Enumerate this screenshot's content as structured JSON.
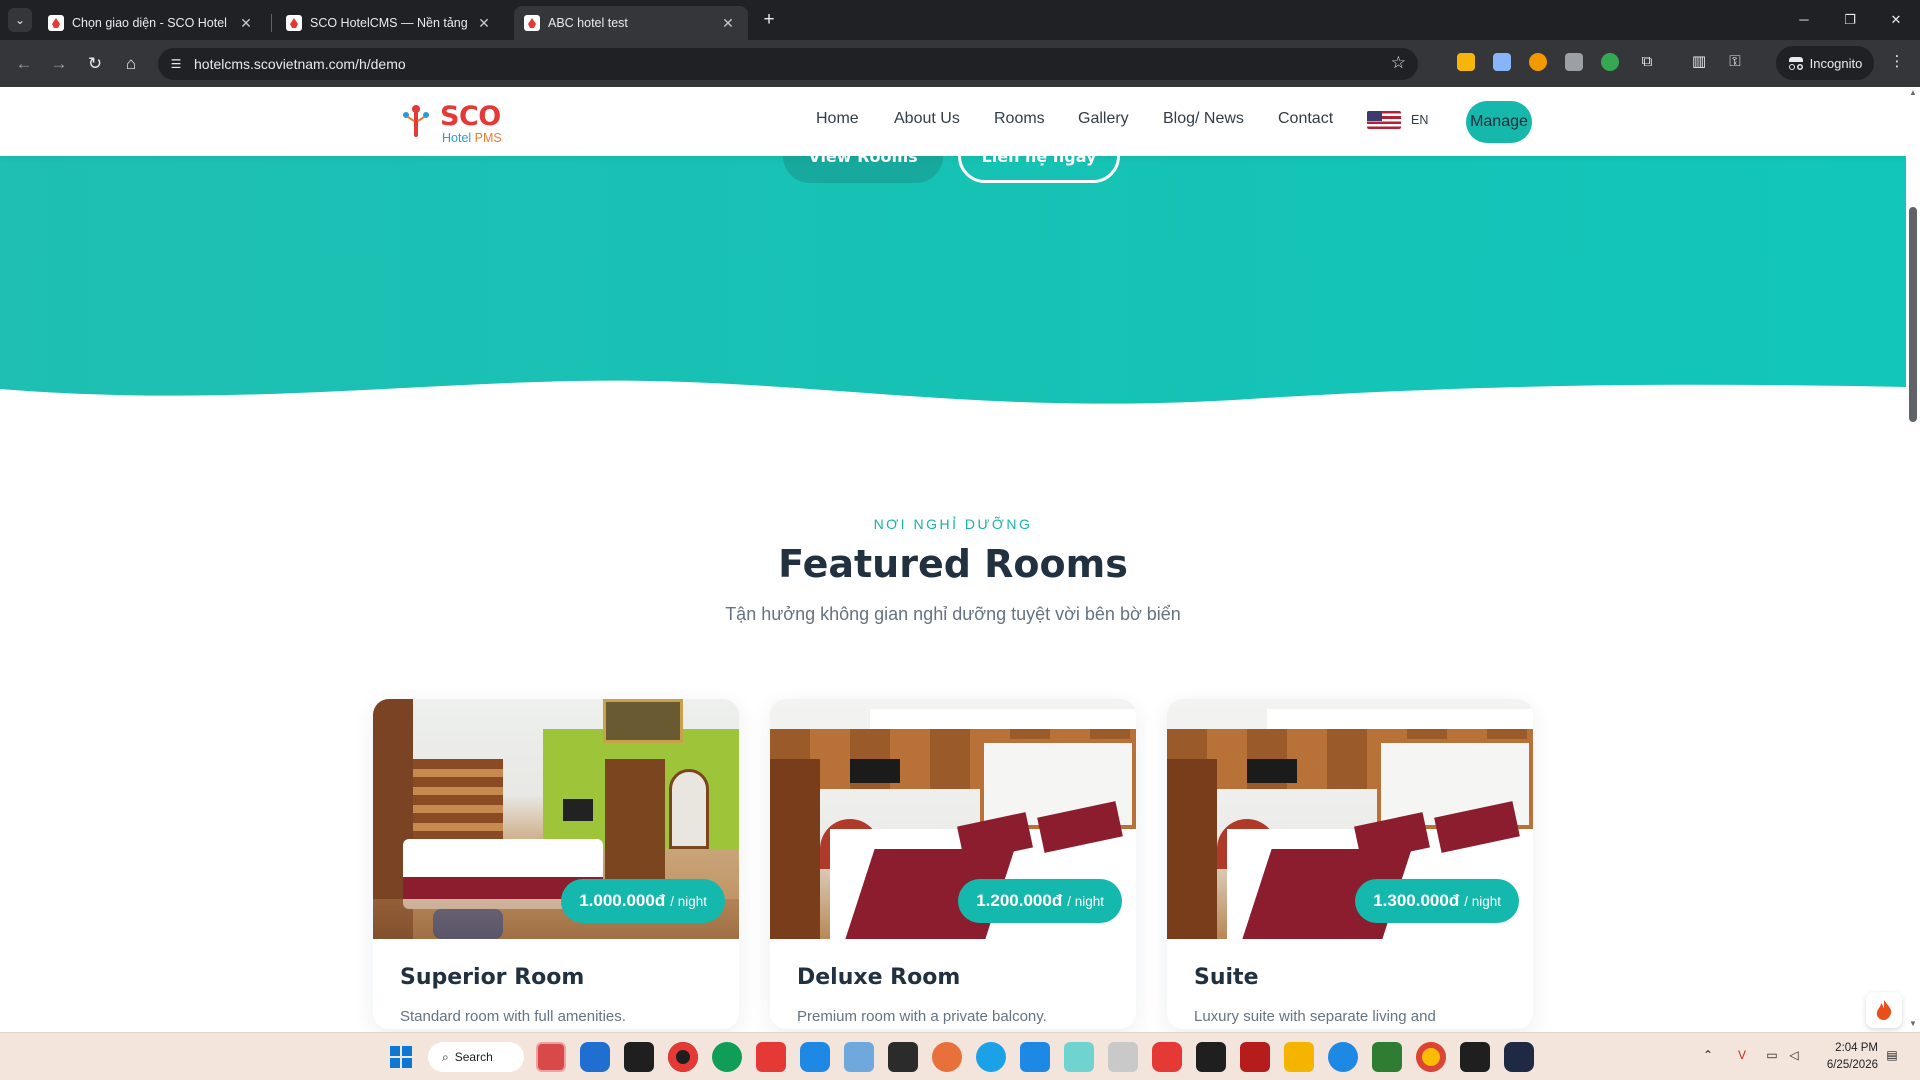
{
  "browser": {
    "tabs": [
      {
        "title": "Chọn giao diện - SCO Hotel CMS",
        "active": false
      },
      {
        "title": "SCO HotelCMS — Nền tảng website",
        "active": false
      },
      {
        "title": "ABC hotel test",
        "active": true
      }
    ],
    "url": "hotelcms.scovietnam.com/h/demo",
    "incognito_label": "Incognito"
  },
  "site": {
    "logo": {
      "word": "SCO",
      "sub_a": "Hotel ",
      "sub_b": "PMS"
    },
    "nav": [
      "Home",
      "About Us",
      "Rooms",
      "Gallery",
      "Blog/ News",
      "Contact"
    ],
    "language": "EN",
    "manage_label": "Manage",
    "hero_buttons": [
      "View Rooms",
      "Liên hệ ngay"
    ],
    "accent_color": "#14b8ac"
  },
  "section": {
    "eyebrow": "NƠI NGHỈ DƯỠNG",
    "title": "Featured Rooms",
    "subtitle": "Tận hưởng không gian nghỉ dưỡng tuyệt vời bên bờ biển"
  },
  "rooms": [
    {
      "name": "Superior Room",
      "price": "1.000.000đ",
      "per": "/ night",
      "description": "Standard room with full amenities."
    },
    {
      "name": "Deluxe Room",
      "price": "1.200.000đ",
      "per": "/ night",
      "description": "Premium room with a private balcony."
    },
    {
      "name": "Suite",
      "price": "1.300.000đ",
      "per": "/ night",
      "description": "Luxury suite with separate living and"
    }
  ],
  "taskbar": {
    "search_label": "Search",
    "time": "2:04 PM",
    "date": "6/25/2026"
  }
}
